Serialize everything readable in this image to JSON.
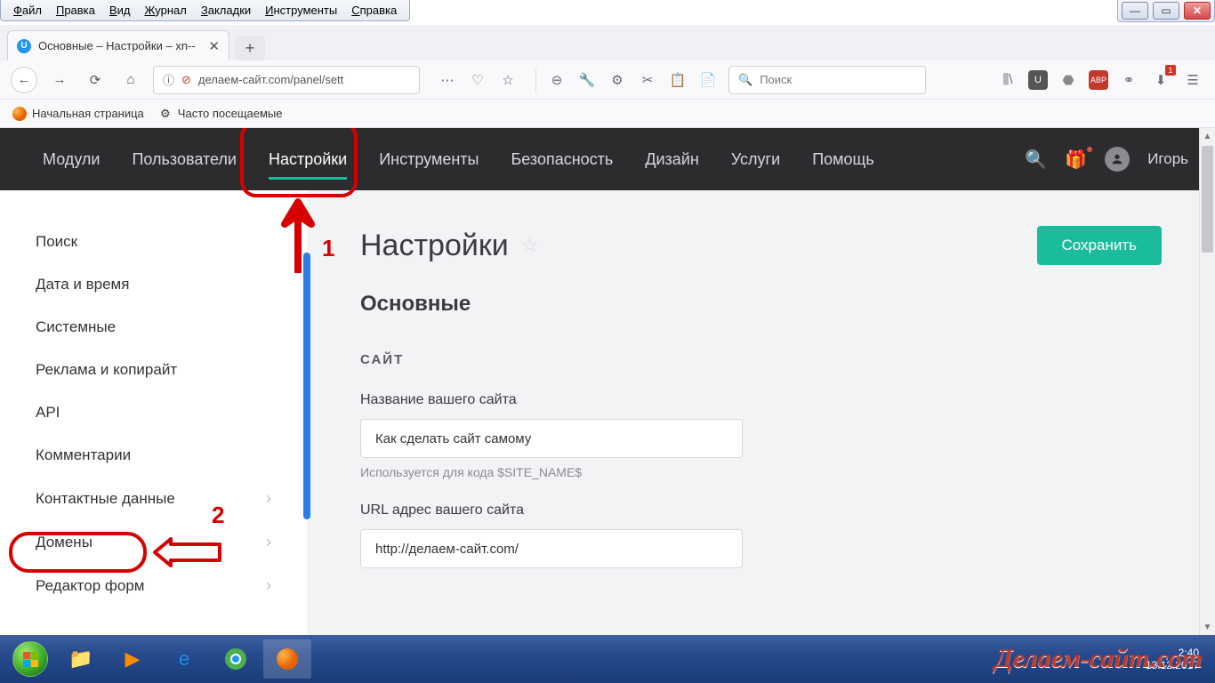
{
  "win_menu": [
    "Файл",
    "Правка",
    "Вид",
    "Журнал",
    "Закладки",
    "Инструменты",
    "Справка"
  ],
  "tab": {
    "title": "Основные – Настройки – xn--"
  },
  "url": "делаем-сайт.com/panel/sett",
  "search_placeholder": "Поиск",
  "bookmarks": {
    "home": "Начальная страница",
    "freq": "Часто посещаемые"
  },
  "topnav": {
    "items": [
      "Модули",
      "Пользователи",
      "Настройки",
      "Инструменты",
      "Безопасность",
      "Дизайн",
      "Услуги",
      "Помощь"
    ],
    "active": 2,
    "user": "Игорь"
  },
  "sidebar": [
    "Поиск",
    "Дата и время",
    "Системные",
    "Реклама и копирайт",
    "API",
    "Комментарии",
    "Контактные данные",
    "Домены",
    "Редактор форм"
  ],
  "page": {
    "title": "Настройки",
    "save": "Сохранить",
    "subtitle": "Основные",
    "section": "САЙТ",
    "f1_label": "Название вашего сайта",
    "f1_value": "Как сделать сайт самому",
    "f1_help": "Используется для кода $SITE_NAME$",
    "f2_label": "URL адрес вашего сайта",
    "f2_value": "http://делаем-сайт.com/"
  },
  "annotations": {
    "n1": "1",
    "n2": "2"
  },
  "tray": {
    "time": "2:40",
    "date": "13.12.2017"
  },
  "watermark": "Делаем-сайт.com"
}
